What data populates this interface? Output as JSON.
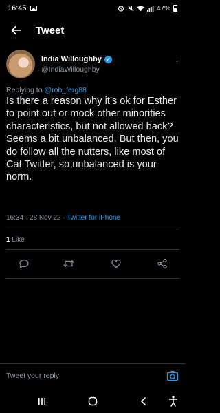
{
  "status_bar": {
    "time": "16:45",
    "battery": "47%",
    "icons": [
      "gallery-icon",
      "alarm-icon",
      "mute-icon",
      "wifi-icon",
      "signal-icon",
      "battery-icon"
    ]
  },
  "header": {
    "title": "Tweet",
    "back_icon": "arrow-left-icon"
  },
  "author": {
    "name": "India Willoughby",
    "handle": "@IndiaWilloughby",
    "verified": true
  },
  "replying": {
    "prefix": "Replying to ",
    "mention": "@rob_ferg88"
  },
  "tweet": {
    "text": "Is there a reason why it’s ok for Esther to point out or mock other minorities characteristics, but not allowed back? Seems a bit unbalanced. But then, you do follow all the nutters, like most of Cat Twitter, so unbalanced is your norm.",
    "timestamp": "16:34 · 28 Nov 22 · ",
    "source": "Twitter for iPhone"
  },
  "engagement": {
    "likes_count": "1",
    "likes_label": " Like"
  },
  "actions": [
    "reply-icon",
    "retweet-icon",
    "like-icon",
    "share-icon"
  ],
  "reply_bar": {
    "placeholder": "Tweet your reply"
  },
  "colors": {
    "background": "#000000",
    "accent": "#1d9bf0",
    "muted": "#8b98a5",
    "divider": "#2f3336"
  }
}
